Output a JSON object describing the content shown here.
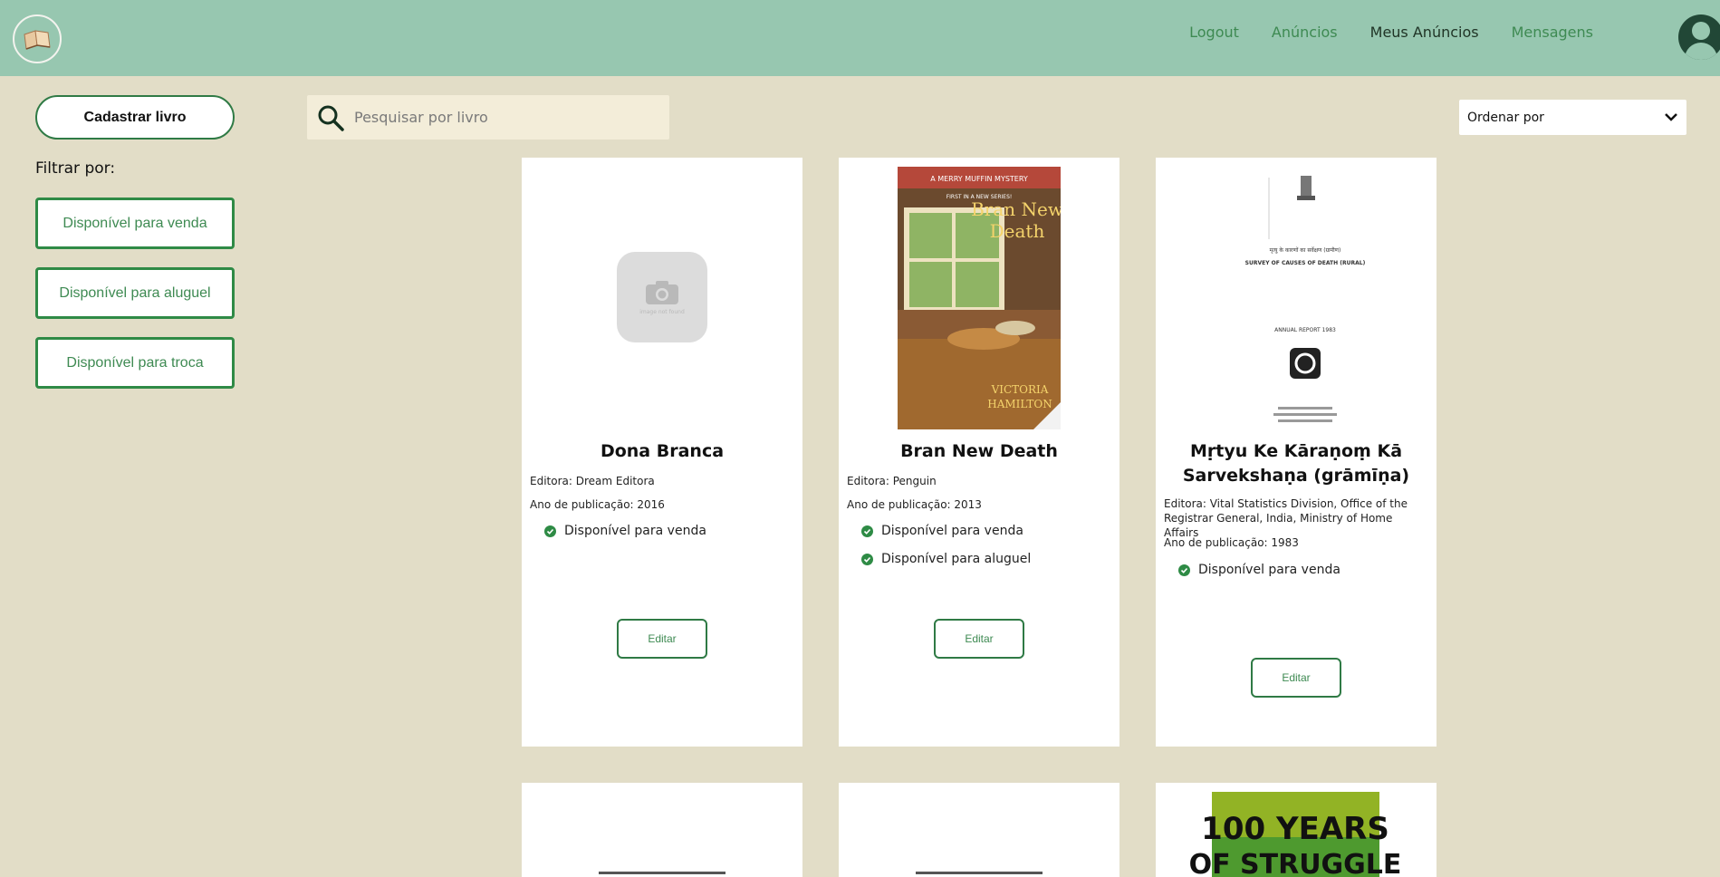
{
  "header": {
    "nav": [
      {
        "label": "Logout"
      },
      {
        "label": "Anúncios"
      },
      {
        "label": "Meus Anúncios"
      },
      {
        "label": "Mensagens"
      }
    ]
  },
  "sidebar": {
    "register_label": "Cadastrar livro",
    "filter_title": "Filtrar por:",
    "filters": [
      {
        "label": "Disponível para venda"
      },
      {
        "label": "Disponível para aluguel"
      },
      {
        "label": "Disponível para troca"
      }
    ]
  },
  "search": {
    "placeholder": "Pesquisar por livro"
  },
  "sort": {
    "label": "Ordenar por"
  },
  "cards": [
    {
      "title": "Dona Branca",
      "publisher": "Editora: Dream Editora",
      "year": "Ano de publicação: 2016",
      "availability": [
        "Disponível para venda"
      ],
      "edit_label": "Editar",
      "placeholder_text": "image not found"
    },
    {
      "title": "Bran New Death",
      "publisher": "Editora: Penguin",
      "year": "Ano de publicação: 2013",
      "availability": [
        "Disponível para venda",
        "Disponível para aluguel"
      ],
      "edit_label": "Editar",
      "cover": {
        "banner": "A MERRY MUFFIN MYSTERY",
        "subbanner": "FIRST IN A NEW SERIES!",
        "title_line1": "Bran New",
        "title_line2": "Death",
        "author_line1": "VICTORIA",
        "author_line2": "HAMILTON"
      }
    },
    {
      "title": "Mṛtyu Ke Kāraṇoṃ Kā Sarvekshaṇa (grāmīṇa)",
      "publisher": "Editora: Vital Statistics Division, Office of the Registrar General, India, Ministry of Home Affairs",
      "year": "Ano de publicação: 1983",
      "availability": [
        "Disponível para venda"
      ],
      "edit_label": "Editar",
      "cover": {
        "hindi_title": "मृत्यु के कारणों का सर्वेक्षण (ग्रामीण)",
        "heading": "SURVEY OF CAUSES OF DEATH (RURAL)",
        "report": "ANNUAL REPORT 1983"
      }
    },
    {
      "title": ""
    },
    {
      "title": ""
    },
    {
      "cover": {
        "line1": "100 YEARS",
        "line2": "OF STRUGGLE"
      }
    }
  ],
  "colors": {
    "header_bg": "#97c7b0",
    "page_bg": "#e2ddc7",
    "accent_green": "#2f8a46"
  }
}
